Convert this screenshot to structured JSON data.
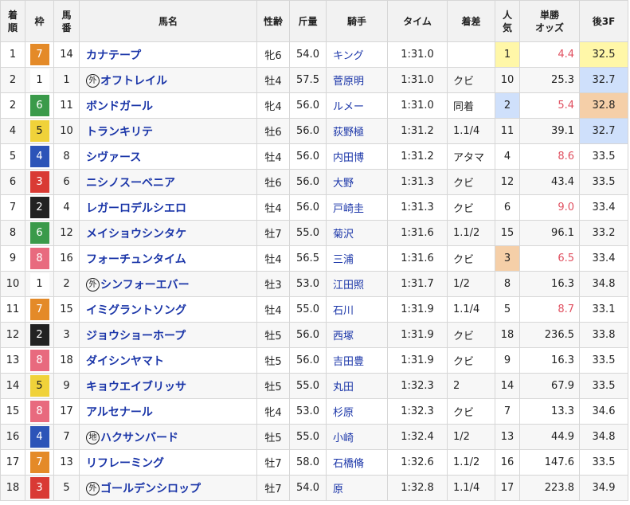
{
  "headers": {
    "rank": "着\n順",
    "waku": "枠",
    "umaban": "馬\n番",
    "name": "馬名",
    "sexage": "性齢",
    "weight": "斤量",
    "jockey": "騎手",
    "time": "タイム",
    "margin": "着差",
    "popularity": "人\n気",
    "odds": "単勝\nオッズ",
    "last3f": "後3F"
  },
  "colors": {
    "waku_1": "#ffffff",
    "waku_2": "#222222",
    "waku_3": "#d93a34",
    "waku_4": "#2c54b8",
    "waku_5": "#f0d23a",
    "waku_6": "#3a9a4a",
    "waku_7": "#e48a28",
    "waku_8": "#e86a7e",
    "popularity_1": "#fff7a8",
    "popularity_2": "#cfe0fb",
    "popularity_3": "#f5cfa8",
    "horse_name": "#1a35a8",
    "odds_highlight": "#e05060"
  },
  "rows": [
    {
      "rank": "1",
      "waku": "7",
      "umaban": "14",
      "mark": "",
      "name": "カナテープ",
      "sexage": "牝6",
      "weight": "54.0",
      "jockey": "キング",
      "time": "1:31.0",
      "margin": "",
      "popularity": "1",
      "odds": "4.4",
      "last3f": "32.5",
      "pop_hl": 1,
      "odds_red": true,
      "l3f_hl": 1
    },
    {
      "rank": "2",
      "waku": "1",
      "umaban": "1",
      "mark": "外",
      "name": "オフトレイル",
      "sexage": "牡4",
      "weight": "57.5",
      "jockey": "菅原明",
      "time": "1:31.0",
      "margin": "クビ",
      "popularity": "10",
      "odds": "25.3",
      "last3f": "32.7",
      "pop_hl": 0,
      "odds_red": false,
      "l3f_hl": 2
    },
    {
      "rank": "2",
      "waku": "6",
      "umaban": "11",
      "mark": "",
      "name": "ボンドガール",
      "sexage": "牝4",
      "weight": "56.0",
      "jockey": "ルメー",
      "time": "1:31.0",
      "margin": "同着",
      "popularity": "2",
      "odds": "5.4",
      "last3f": "32.8",
      "pop_hl": 2,
      "odds_red": true,
      "l3f_hl": 3
    },
    {
      "rank": "4",
      "waku": "5",
      "umaban": "10",
      "mark": "",
      "name": "トランキリテ",
      "sexage": "牡6",
      "weight": "56.0",
      "jockey": "荻野極",
      "time": "1:31.2",
      "margin": "1.1/4",
      "popularity": "11",
      "odds": "39.1",
      "last3f": "32.7",
      "pop_hl": 0,
      "odds_red": false,
      "l3f_hl": 2
    },
    {
      "rank": "5",
      "waku": "4",
      "umaban": "8",
      "mark": "",
      "name": "シヴァース",
      "sexage": "牡4",
      "weight": "56.0",
      "jockey": "内田博",
      "time": "1:31.2",
      "margin": "アタマ",
      "popularity": "4",
      "odds": "8.6",
      "last3f": "33.5",
      "pop_hl": 0,
      "odds_red": true,
      "l3f_hl": 0
    },
    {
      "rank": "6",
      "waku": "3",
      "umaban": "6",
      "mark": "",
      "name": "ニシノスーベニア",
      "sexage": "牡6",
      "weight": "56.0",
      "jockey": "大野",
      "time": "1:31.3",
      "margin": "クビ",
      "popularity": "12",
      "odds": "43.4",
      "last3f": "33.5",
      "pop_hl": 0,
      "odds_red": false,
      "l3f_hl": 0
    },
    {
      "rank": "7",
      "waku": "2",
      "umaban": "4",
      "mark": "",
      "name": "レガーロデルシエロ",
      "sexage": "牡4",
      "weight": "56.0",
      "jockey": "戸崎圭",
      "time": "1:31.3",
      "margin": "クビ",
      "popularity": "6",
      "odds": "9.0",
      "last3f": "33.4",
      "pop_hl": 0,
      "odds_red": true,
      "l3f_hl": 0
    },
    {
      "rank": "8",
      "waku": "6",
      "umaban": "12",
      "mark": "",
      "name": "メイショウシンタケ",
      "sexage": "牡7",
      "weight": "55.0",
      "jockey": "菊沢",
      "time": "1:31.6",
      "margin": "1.1/2",
      "popularity": "15",
      "odds": "96.1",
      "last3f": "33.2",
      "pop_hl": 0,
      "odds_red": false,
      "l3f_hl": 0
    },
    {
      "rank": "9",
      "waku": "8",
      "umaban": "16",
      "mark": "",
      "name": "フォーチュンタイム",
      "sexage": "牡4",
      "weight": "56.5",
      "jockey": "三浦",
      "time": "1:31.6",
      "margin": "クビ",
      "popularity": "3",
      "odds": "6.5",
      "last3f": "33.4",
      "pop_hl": 3,
      "odds_red": true,
      "l3f_hl": 0
    },
    {
      "rank": "10",
      "waku": "1",
      "umaban": "2",
      "mark": "外",
      "name": "シンフォーエバー",
      "sexage": "牡3",
      "weight": "53.0",
      "jockey": "江田照",
      "time": "1:31.7",
      "margin": "1/2",
      "popularity": "8",
      "odds": "16.3",
      "last3f": "34.8",
      "pop_hl": 0,
      "odds_red": false,
      "l3f_hl": 0
    },
    {
      "rank": "11",
      "waku": "7",
      "umaban": "15",
      "mark": "",
      "name": "イミグラントソング",
      "sexage": "牡4",
      "weight": "55.0",
      "jockey": "石川",
      "time": "1:31.9",
      "margin": "1.1/4",
      "popularity": "5",
      "odds": "8.7",
      "last3f": "33.1",
      "pop_hl": 0,
      "odds_red": true,
      "l3f_hl": 0
    },
    {
      "rank": "12",
      "waku": "2",
      "umaban": "3",
      "mark": "",
      "name": "ジョウショーホープ",
      "sexage": "牡5",
      "weight": "56.0",
      "jockey": "西塚",
      "time": "1:31.9",
      "margin": "クビ",
      "popularity": "18",
      "odds": "236.5",
      "last3f": "33.8",
      "pop_hl": 0,
      "odds_red": false,
      "l3f_hl": 0
    },
    {
      "rank": "13",
      "waku": "8",
      "umaban": "18",
      "mark": "",
      "name": "ダイシンヤマト",
      "sexage": "牡5",
      "weight": "56.0",
      "jockey": "吉田豊",
      "time": "1:31.9",
      "margin": "クビ",
      "popularity": "9",
      "odds": "16.3",
      "last3f": "33.5",
      "pop_hl": 0,
      "odds_red": false,
      "l3f_hl": 0
    },
    {
      "rank": "14",
      "waku": "5",
      "umaban": "9",
      "mark": "",
      "name": "キョウエイブリッサ",
      "sexage": "牡5",
      "weight": "55.0",
      "jockey": "丸田",
      "time": "1:32.3",
      "margin": "2",
      "popularity": "14",
      "odds": "67.9",
      "last3f": "33.5",
      "pop_hl": 0,
      "odds_red": false,
      "l3f_hl": 0
    },
    {
      "rank": "15",
      "waku": "8",
      "umaban": "17",
      "mark": "",
      "name": "アルセナール",
      "sexage": "牝4",
      "weight": "53.0",
      "jockey": "杉原",
      "time": "1:32.3",
      "margin": "クビ",
      "popularity": "7",
      "odds": "13.3",
      "last3f": "34.6",
      "pop_hl": 0,
      "odds_red": false,
      "l3f_hl": 0
    },
    {
      "rank": "16",
      "waku": "4",
      "umaban": "7",
      "mark": "地",
      "name": "ハクサンバード",
      "sexage": "牡5",
      "weight": "55.0",
      "jockey": "小崎",
      "time": "1:32.4",
      "margin": "1/2",
      "popularity": "13",
      "odds": "44.9",
      "last3f": "34.8",
      "pop_hl": 0,
      "odds_red": false,
      "l3f_hl": 0
    },
    {
      "rank": "17",
      "waku": "7",
      "umaban": "13",
      "mark": "",
      "name": "リフレーミング",
      "sexage": "牡7",
      "weight": "58.0",
      "jockey": "石橋脩",
      "time": "1:32.6",
      "margin": "1.1/2",
      "popularity": "16",
      "odds": "147.6",
      "last3f": "33.5",
      "pop_hl": 0,
      "odds_red": false,
      "l3f_hl": 0
    },
    {
      "rank": "18",
      "waku": "3",
      "umaban": "5",
      "mark": "外",
      "name": "ゴールデンシロップ",
      "sexage": "牡7",
      "weight": "54.0",
      "jockey": "原",
      "time": "1:32.8",
      "margin": "1.1/4",
      "popularity": "17",
      "odds": "223.8",
      "last3f": "34.9",
      "pop_hl": 0,
      "odds_red": false,
      "l3f_hl": 0
    }
  ]
}
